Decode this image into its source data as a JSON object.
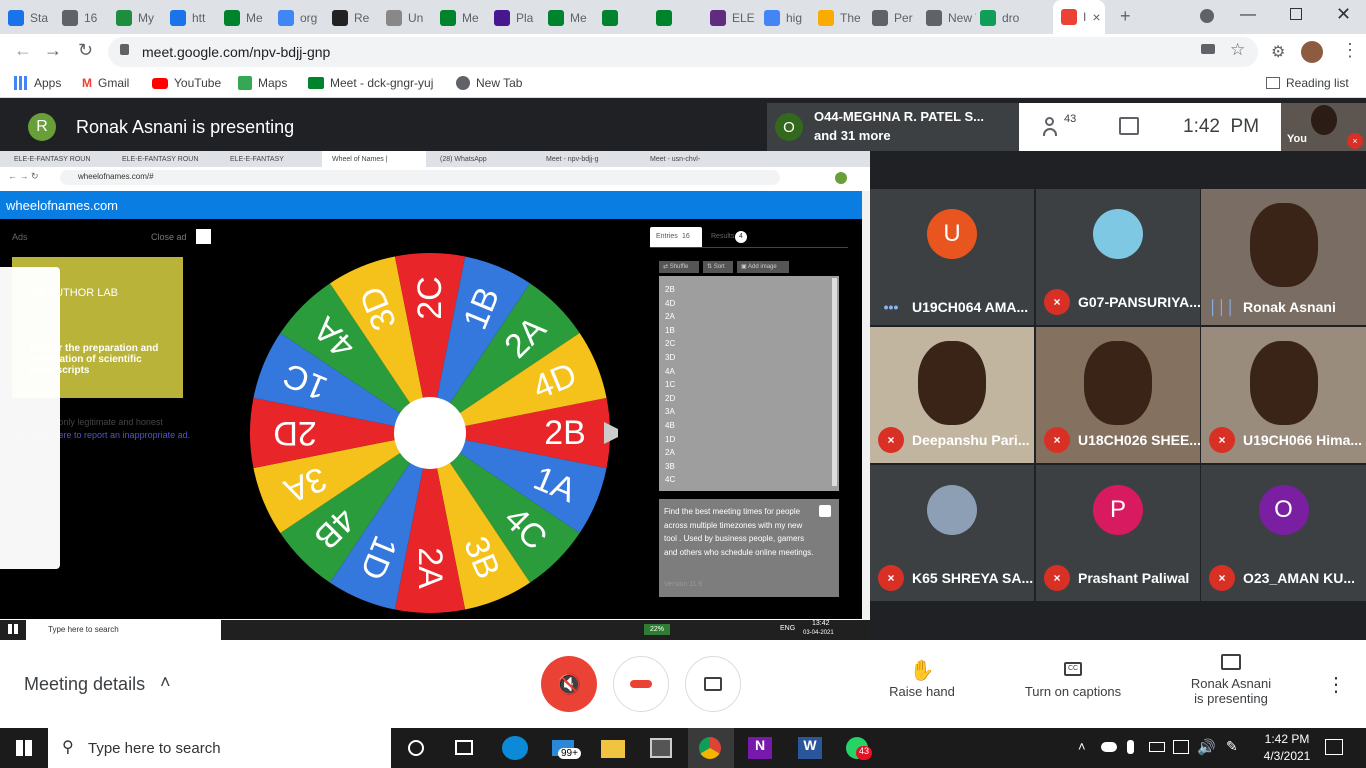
{
  "browser": {
    "tabs": [
      "Sta",
      "16",
      "My",
      "htt",
      "Me",
      "org",
      "Re",
      "Un",
      "Me",
      "Pla",
      "Me",
      "",
      "",
      "ELE",
      "hig",
      "The",
      "Per",
      "New Ta",
      "dro",
      "I"
    ],
    "url": "meet.google.com/npv-bdjj-gnp",
    "bookmarks": [
      "Apps",
      "Gmail",
      "YouTube",
      "Maps",
      "Meet - dck-gngr-yuj",
      "New Tab"
    ],
    "reading_list": "Reading list"
  },
  "meet": {
    "presenter_initial": "R",
    "presenter_text": "Ronak Asnani is presenting",
    "pin_initial": "O",
    "pin_name": "O44-MEGHNA R. PATEL S...",
    "pin_more": "and 31 more",
    "people_count": "43",
    "clock": "1:42  PM",
    "self_label": "You",
    "meeting_details": "Meeting details",
    "raise_hand": "Raise hand",
    "captions": "Turn on captions",
    "presenting_line1": "Ronak Asnani",
    "presenting_line2": "is presenting"
  },
  "participants": [
    {
      "initial": "U",
      "name": "U19CH064 AMA...",
      "color": "#e8551f"
    },
    {
      "initial": "",
      "name": "G07-PANSURIYA...",
      "color": "#7ec8e3"
    },
    {
      "initial": "",
      "name": "Ronak Asnani",
      "color": ""
    },
    {
      "initial": "",
      "name": "Deepanshu Pari...",
      "color": ""
    },
    {
      "initial": "",
      "name": "U18CH026 SHEE...",
      "color": ""
    },
    {
      "initial": "",
      "name": "U19CH066 Hima...",
      "color": ""
    },
    {
      "initial": "",
      "name": "K65 SHREYA SA...",
      "color": "#8d9fb5"
    },
    {
      "initial": "P",
      "name": "Prashant Paliwal",
      "color": "#d81b60"
    },
    {
      "initial": "O",
      "name": "O23_AMAN KU...",
      "color": "#7b1fa2"
    }
  ],
  "shared": {
    "tabs": [
      "ELE-E-FANTASY ROUN",
      "ELE-E-FANTASY ROUN",
      "ELE-E-FANTASY",
      "Wheel of Names |",
      "(28) WhatsApp",
      "Meet - npv-bdjj-g",
      "Meet - usn-chvl-"
    ],
    "url": "wheelofnames.com/#",
    "site": "wheelofnames.com",
    "ads": "Ads",
    "close_ad": "Close ad",
    "ad_text": "Master the preparation and publication of scientific manuscripts",
    "ad_brand": "CS AUTHOR LAB",
    "ad_note1": "We display only legitimate and honest",
    "ad_note2": "ads. Click here to report an inappropriate ad.",
    "entries_tab": "Entries",
    "entries_count": "16",
    "results_tab": "Results",
    "results_count": "4",
    "shuffle": "Shuffle",
    "sort": "Sort",
    "add_image": "Add image",
    "entries": [
      "2B",
      "4D",
      "2A",
      "1B",
      "2C",
      "3D",
      "4A",
      "1C",
      "2D",
      "3A",
      "4B",
      "1D",
      "2A",
      "3B",
      "4C"
    ],
    "info": "Find the best meeting times for people across multiple timezones with my new tool . Used by business people, gamers and others who schedule online meetings.",
    "version": "Version 11.6",
    "wheel": [
      "2B",
      "1A",
      "4C",
      "3B",
      "2A",
      "1D",
      "4B",
      "3A",
      "2D",
      "1C",
      "4A",
      "3D",
      "2C",
      "1B",
      "2A",
      "4D"
    ],
    "wheel_colors": [
      "#e8262a",
      "#3478dd",
      "#2a9c3c",
      "#f5c21b"
    ],
    "search_placeholder": "Type here to search",
    "tray_time": "13:42",
    "tray_date": "03-04-2021",
    "tray_lang": "ENG",
    "battery": "22%"
  },
  "taskbar": {
    "search": "Type here to search",
    "mail_badge": "99+",
    "whatsapp_badge": "43",
    "time": "1:42 PM",
    "date": "4/3/2021"
  }
}
